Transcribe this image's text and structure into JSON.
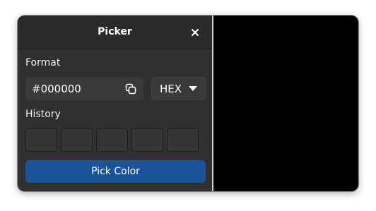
{
  "window": {
    "title": "Picker"
  },
  "format": {
    "label": "Format",
    "value": "#000000",
    "copy_icon": "copy-icon",
    "type_selected": "HEX"
  },
  "history": {
    "label": "History",
    "swatch_count": 5
  },
  "pick_button": {
    "label": "Pick Color",
    "color": "#1c5299"
  },
  "preview": {
    "color": "#000000"
  }
}
